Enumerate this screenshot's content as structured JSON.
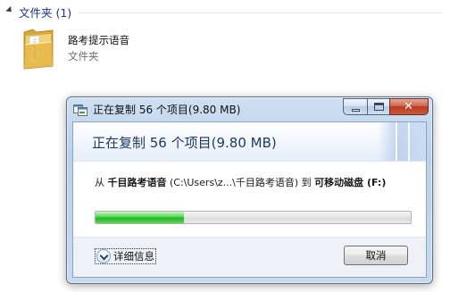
{
  "explorer": {
    "group_title": "文件夹 (1)",
    "folder": {
      "name": "路考提示语音",
      "type": "文件夹",
      "icon": "folder-icon"
    }
  },
  "dialog": {
    "title": "正在复制 56 个项目(9.80 MB)",
    "heading": "正在复制 56 个项目(9.80 MB)",
    "detail": {
      "from_word": "从",
      "source_name": "千目路考语音",
      "source_path": "(C:\\Users\\z...\\千目路考语音)",
      "to_word": "到",
      "dest_name": "可移动磁盘 (F:)"
    },
    "progress_fraction": 0.28,
    "more_details_label": "详细信息",
    "cancel_label": "取消",
    "colors": {
      "progress_green": "#22b922",
      "close_red": "#c8482b",
      "heading_blue": "#1e395b"
    }
  }
}
